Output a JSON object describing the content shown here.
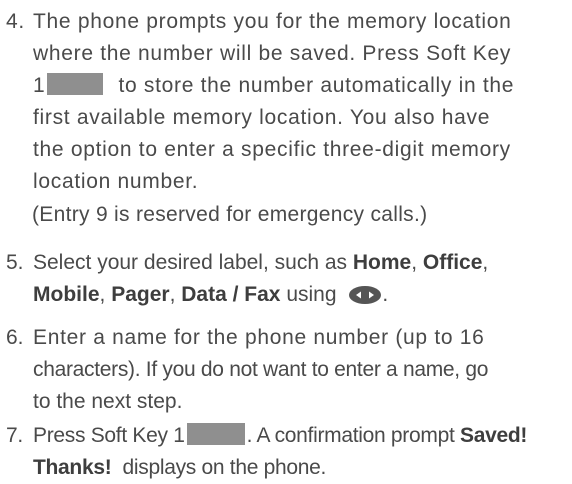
{
  "steps": [
    {
      "number": "4.",
      "lines": [
        "The phone prompts you for the memory location",
        "where the number will be saved. Press Soft Key",
        "to store the number automatically in the",
        "first available memory location. You also have",
        "the option to enter a specific three-digit memory",
        "location number."
      ],
      "key_number": "1"
    },
    {
      "note": "(Entry 9 is reserved for emergency calls.)"
    },
    {
      "number": "5.",
      "text_before": "Select your desired label, such as",
      "labels": [
        "Home",
        "Office",
        "Mobile",
        "Pager",
        "Data / Fax"
      ],
      "comma": ",",
      "text_using": "using",
      "icon": "navigation-key-icon",
      "period": "."
    },
    {
      "number": "6.",
      "lines": [
        "Enter a name for the phone number (up to 16",
        "characters). If you do not want to enter a name, go",
        "to the next step."
      ]
    },
    {
      "number": "7.",
      "text_before": "Press Soft Key 1",
      "text_after": ". A confirmation prompt",
      "bold_1": "Saved!",
      "bold_2": "Thanks!",
      "text_end": "displays on the phone."
    }
  ],
  "colors": {
    "text": "#4a4a4a",
    "key_box": "#8f8f8f",
    "icon": "#555555"
  }
}
